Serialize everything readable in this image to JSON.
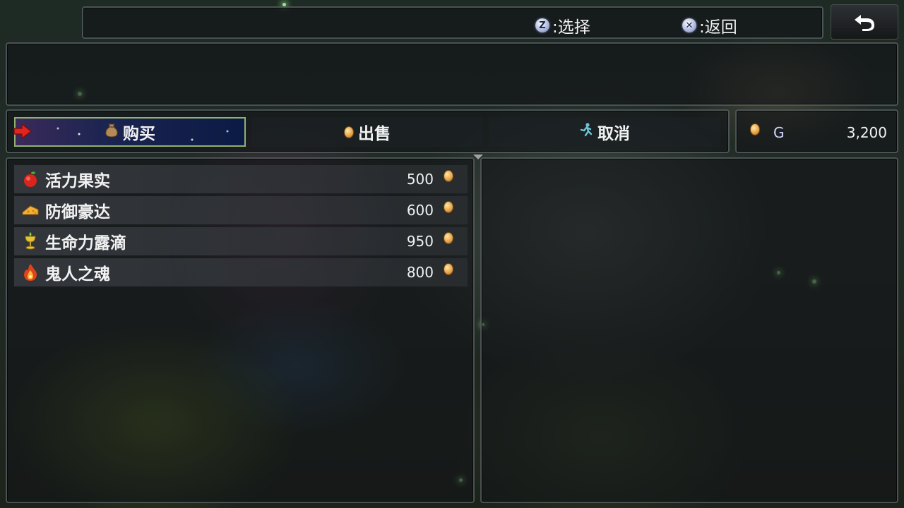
{
  "hints": {
    "select_key": "Z",
    "select_label": ":选择",
    "back_key": "✕",
    "back_label": ":返回"
  },
  "commands": [
    {
      "label": "购买",
      "icon": "bag-icon",
      "selected": true
    },
    {
      "label": "出售",
      "icon": "coin-icon",
      "selected": false
    },
    {
      "label": "取消",
      "icon": "running-man-icon",
      "selected": false
    }
  ],
  "gold": {
    "unit": "G",
    "amount": "3,200"
  },
  "items": [
    {
      "name": "活力果实",
      "price": "500",
      "icon": "apple-icon"
    },
    {
      "name": "防御豪达",
      "price": "600",
      "icon": "cheese-icon"
    },
    {
      "name": "生命力露滴",
      "price": "950",
      "icon": "goblet-icon"
    },
    {
      "name": "鬼人之魂",
      "price": "800",
      "icon": "flame-icon"
    }
  ],
  "colors": {
    "selected_border": "#8fb070",
    "cursor_arrow": "#e0241e",
    "coin": "#e3a046"
  }
}
